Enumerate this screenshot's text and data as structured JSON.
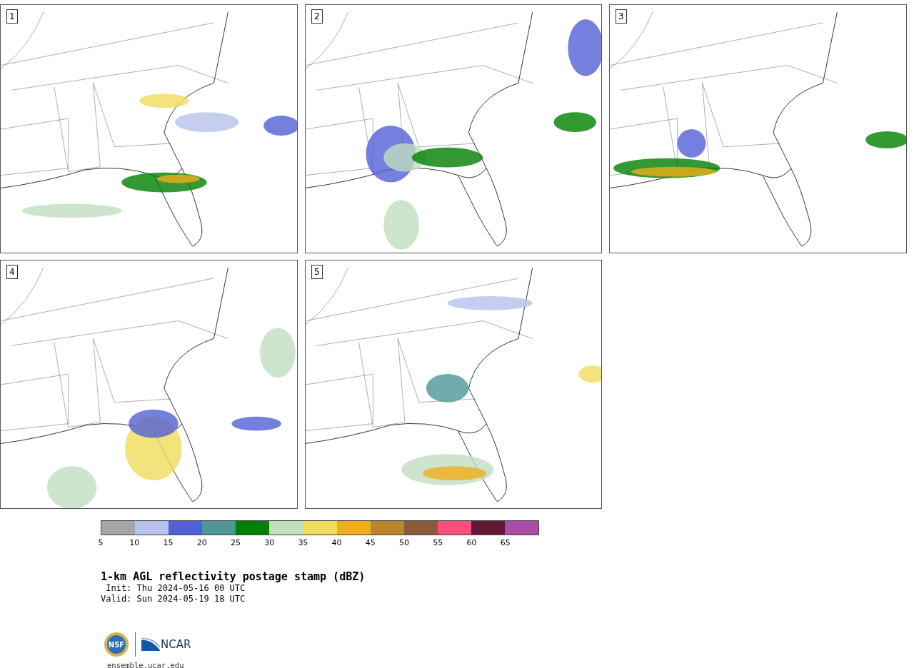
{
  "panels": [
    {
      "label": "1"
    },
    {
      "label": "2"
    },
    {
      "label": "3"
    },
    {
      "label": "4"
    },
    {
      "label": "5"
    }
  ],
  "colorbar": {
    "bins": [
      {
        "color": "#a6a6a6",
        "tick": "5"
      },
      {
        "color": "#b8c2ec",
        "tick": "10"
      },
      {
        "color": "#525fd6",
        "tick": "15"
      },
      {
        "color": "#4d9699",
        "tick": "20"
      },
      {
        "color": "#008000",
        "tick": "25"
      },
      {
        "color": "#bfdfbf",
        "tick": "30"
      },
      {
        "color": "#f0dc5c",
        "tick": "35"
      },
      {
        "color": "#efae1a",
        "tick": "40"
      },
      {
        "color": "#bb8530",
        "tick": "45"
      },
      {
        "color": "#8b5a3c",
        "tick": "50"
      },
      {
        "color": "#f5507c",
        "tick": "55"
      },
      {
        "color": "#611935",
        "tick": "60"
      },
      {
        "color": "#ad4ca6",
        "tick": "65"
      }
    ]
  },
  "title": "1-km AGL reflectivity postage stamp (dBZ)",
  "init": " Init: Thu 2024-05-16 00 UTC",
  "valid": "Valid: Sun 2024-05-19 18 UTC",
  "logos": {
    "nsf": "NSF",
    "ncar": "NCAR"
  },
  "url": "ensemble.ucar.edu"
}
